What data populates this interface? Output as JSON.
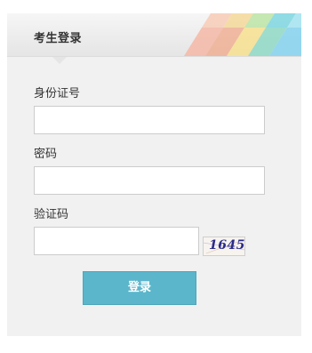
{
  "panel": {
    "title": "考生登录"
  },
  "form": {
    "id_label": "身份证号",
    "id_value": "",
    "password_label": "密码",
    "password_value": "",
    "captcha_label": "验证码",
    "captcha_value": "",
    "captcha_image_text": "1645",
    "submit_label": "登录"
  },
  "colors": {
    "panel_bg": "#f1f1f1",
    "button_bg": "#5bb6cb",
    "button_text": "#ffffff",
    "label_text": "#333333"
  }
}
